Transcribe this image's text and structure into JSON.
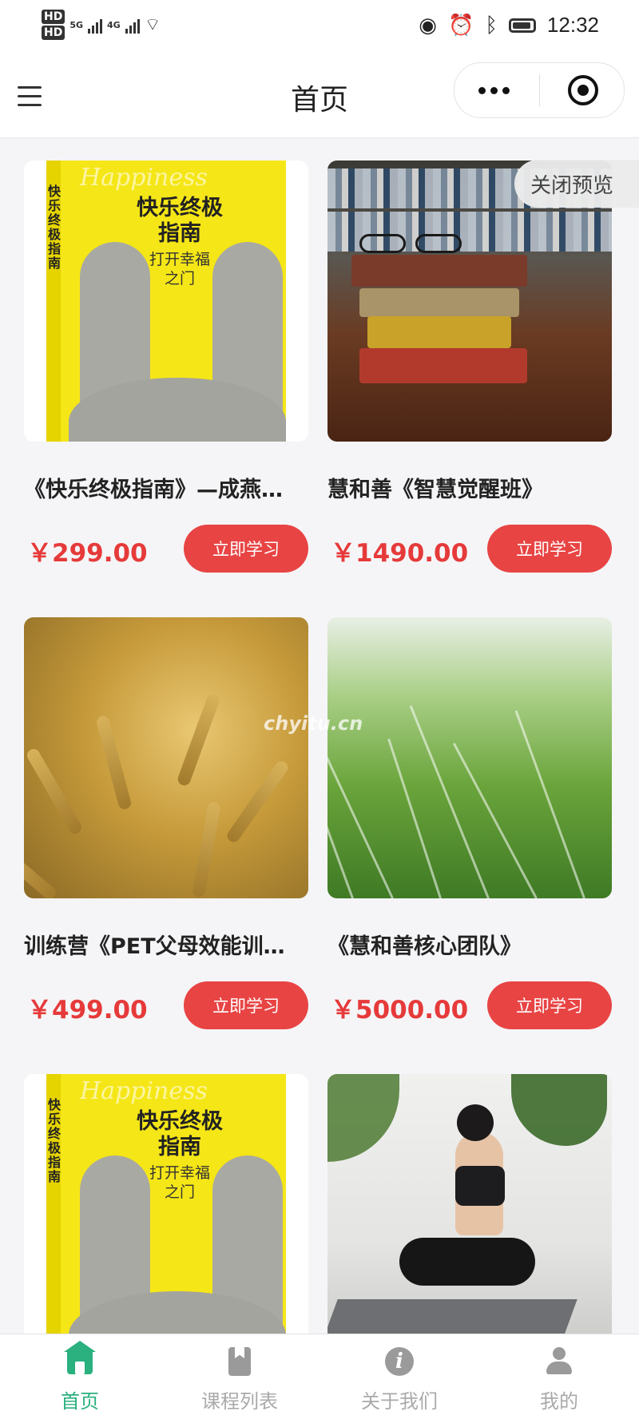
{
  "statusbar": {
    "sim1": "HD",
    "sim2": "HD",
    "net1": "5G",
    "net2": "4G",
    "time": "12:32"
  },
  "header": {
    "title": "首页",
    "icons": [
      "menu-icon",
      "more-icon",
      "close-miniprogram-icon"
    ]
  },
  "preview": {
    "close_label": "关闭预览"
  },
  "courses": [
    {
      "title": "《快乐终极指南》—成燕…",
      "price": "￥299.00",
      "button": "立即学习",
      "image": "book-cover-happiness"
    },
    {
      "title": "慧和善《智慧觉醒班》",
      "price": "￥1490.00",
      "button": "立即学习",
      "image": "library-books-glasses"
    },
    {
      "title": "训练营《PET父母效能训…",
      "price": "￥499.00",
      "button": "立即学习",
      "image": "wheat-field"
    },
    {
      "title": "《慧和善核心团队》",
      "price": "￥5000.00",
      "button": "立即学习",
      "image": "green-grass-field"
    },
    {
      "image": "book-cover-happiness"
    },
    {
      "image": "yoga-meditation"
    }
  ],
  "book_cover": {
    "brand": "Happiness",
    "title": "快乐终极指南",
    "subtitle": "打开幸福之门",
    "spine": "快乐终极指南"
  },
  "watermark": "chyitu.cn",
  "tabs": [
    {
      "label": "首页",
      "active": true,
      "icon": "home-icon"
    },
    {
      "label": "课程列表",
      "active": false,
      "icon": "book-icon"
    },
    {
      "label": "关于我们",
      "active": false,
      "icon": "info-icon"
    },
    {
      "label": "我的",
      "active": false,
      "icon": "user-icon"
    }
  ],
  "colors": {
    "accent": "#2bb07f",
    "price": "#e63a3a",
    "button": "#e84444"
  }
}
